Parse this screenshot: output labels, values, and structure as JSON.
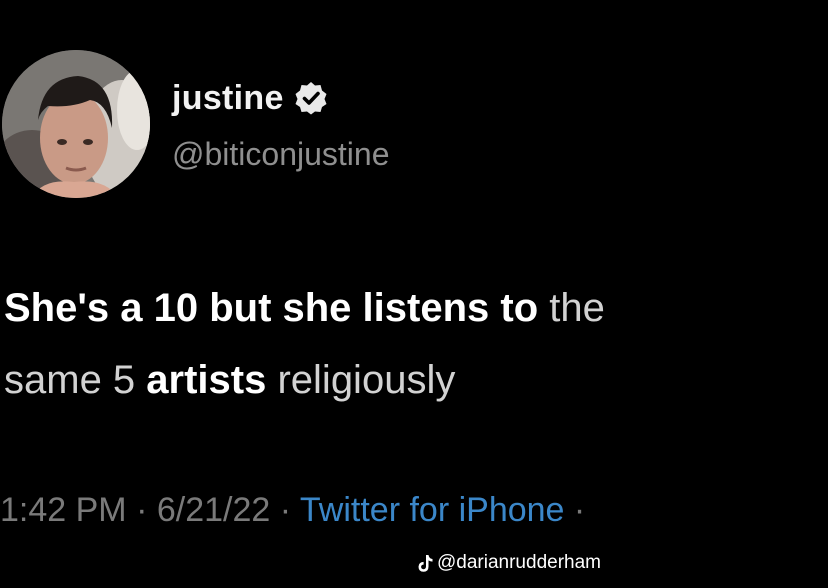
{
  "profile": {
    "display_name": "justine",
    "handle": "@biticonjustine",
    "verified_icon": "verified-check-icon",
    "avatar_icon": "profile-photo"
  },
  "tweet": {
    "line1": {
      "seg1": "She's a 10 but she listens to",
      "seg2": " the"
    },
    "line2": {
      "seg1": "same 5 ",
      "seg2": "artists",
      "seg3": " religiously"
    }
  },
  "meta": {
    "time": "1:42 PM",
    "sep1": " · ",
    "date": "6/21/22",
    "sep2": " · ",
    "source": "Twitter for iPhone",
    "sep3": " ·"
  },
  "watermark": {
    "icon": "tiktok-icon",
    "text": "@darianrudderham"
  },
  "colors": {
    "background": "#000000",
    "link": "#3b87c9",
    "secondary_text": "#8f8f8f"
  }
}
